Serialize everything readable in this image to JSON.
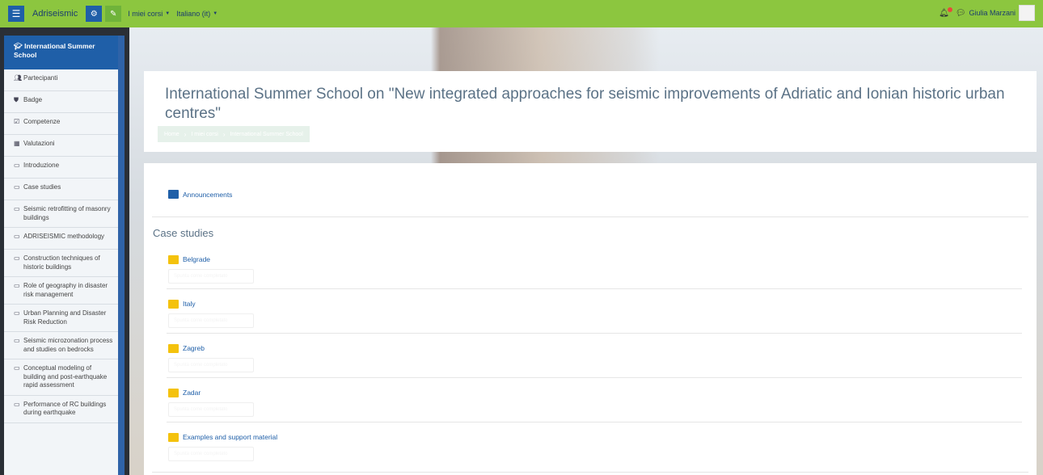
{
  "topbar": {
    "site_name": "Adriseismic",
    "menu_my_courses": "I miei corsi",
    "menu_language": "Italiano (it)",
    "user_name": "Giulia Marzani",
    "icons": [
      "menu-icon",
      "gear-icon",
      "edit-icon",
      "bell-icon",
      "chat-icon"
    ],
    "color": "#8cc63f"
  },
  "sidebar": {
    "course_title": "International Summer School",
    "items": [
      {
        "icon": "users-icon",
        "label": "Partecipanti"
      },
      {
        "icon": "shield-icon",
        "label": "Badge"
      },
      {
        "icon": "checkbox-icon",
        "label": "Competenze"
      },
      {
        "icon": "grid-icon",
        "label": "Valutazioni"
      },
      {
        "icon": "folder-outline-icon",
        "label": "Introduzione"
      },
      {
        "icon": "folder-outline-icon",
        "label": "Case studies"
      },
      {
        "icon": "folder-outline-icon",
        "label": "Seismic retrofitting of masonry buildings"
      },
      {
        "icon": "folder-outline-icon",
        "label": "ADRISEISMIC methodology"
      },
      {
        "icon": "folder-outline-icon",
        "label": "Construction techniques of historic buildings"
      },
      {
        "icon": "folder-outline-icon",
        "label": "Role of geography in disaster risk management"
      },
      {
        "icon": "folder-outline-icon",
        "label": "Urban Planning and Disaster Risk Reduction"
      },
      {
        "icon": "folder-outline-icon",
        "label": "Seismic microzonation process and studies on bedrocks"
      },
      {
        "icon": "folder-outline-icon",
        "label": "Conceptual modeling of building and post-earthquake rapid assessment"
      },
      {
        "icon": "folder-outline-icon",
        "label": "Performance of RC buildings during earthquake"
      }
    ]
  },
  "header": {
    "title": "International Summer School on \"New integrated approaches for seismic improvements of Adriatic and Ionian historic urban centres\"",
    "breadcrumb": [
      "Home",
      "I miei corsi",
      "International Summer School"
    ]
  },
  "main": {
    "announcements": "Announcements",
    "section_title": "Case studies",
    "activities": [
      {
        "label": "Belgrade",
        "restriction": "Spunta come completato"
      },
      {
        "label": "Italy",
        "restriction": "Spunta come completato"
      },
      {
        "label": "Zagreb",
        "restriction": "Spunta come completato"
      },
      {
        "label": "Zadar",
        "restriction": "Spunta come completato"
      },
      {
        "label": "Examples and support material",
        "restriction": "Spunta come completato"
      }
    ]
  }
}
